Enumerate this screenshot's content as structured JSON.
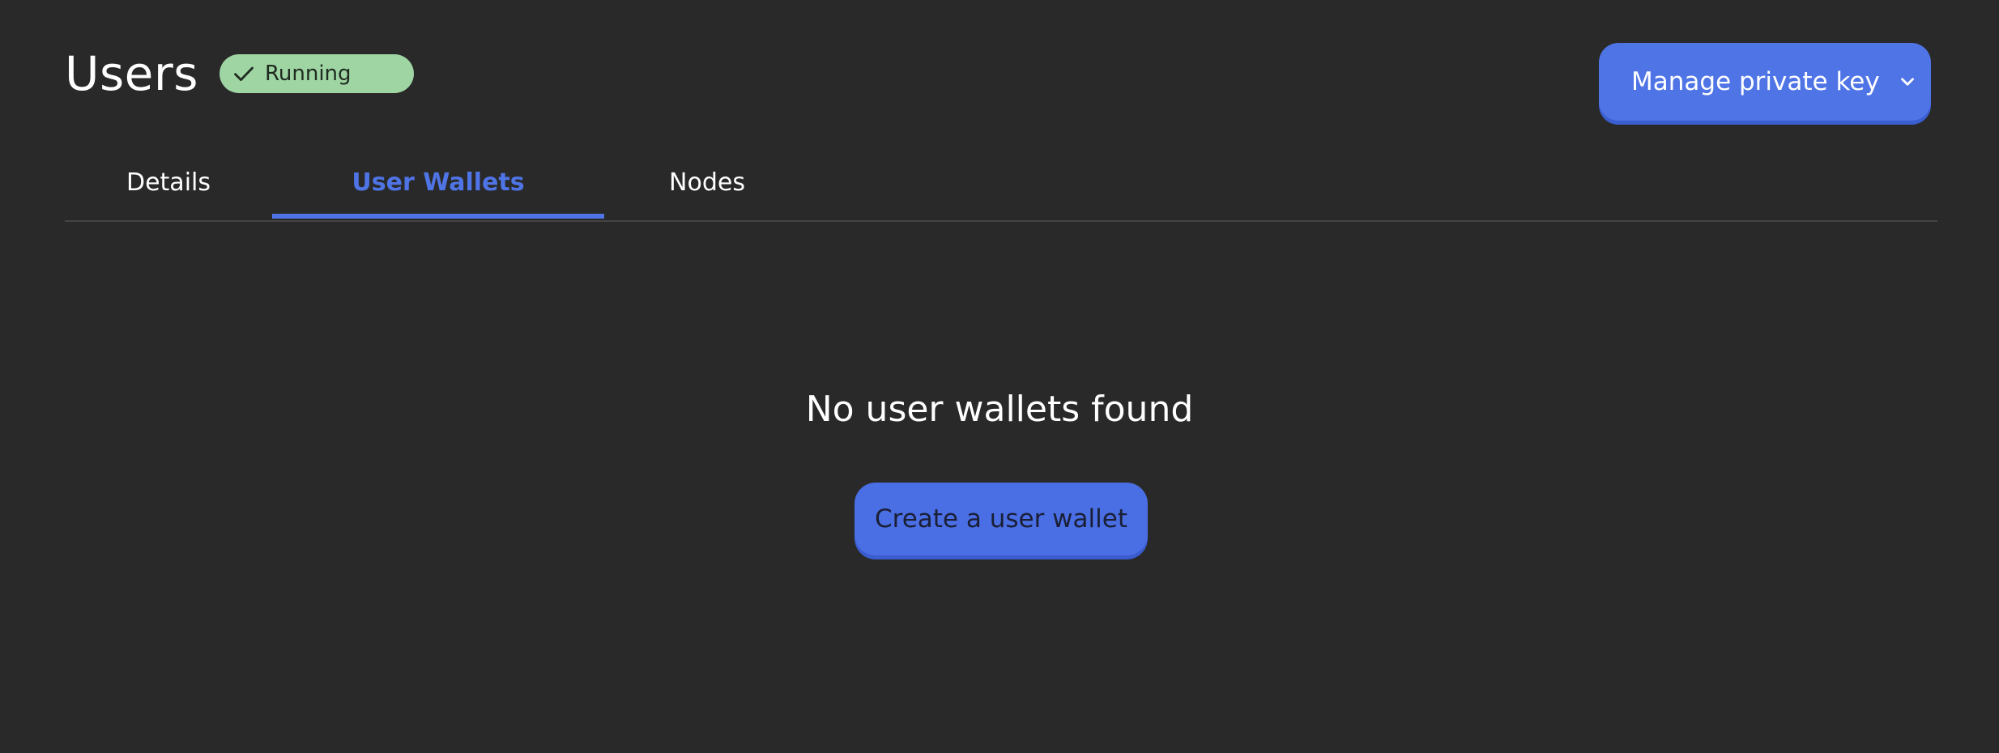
{
  "header": {
    "title": "Users",
    "status": {
      "label": "Running",
      "icon": "check-icon",
      "color": "#9ed5a3"
    },
    "manage_button": {
      "label": "Manage private key",
      "icon": "chevron-down-icon"
    }
  },
  "tabs": [
    {
      "label": "Details",
      "active": false
    },
    {
      "label": "User Wallets",
      "active": true
    },
    {
      "label": "Nodes",
      "active": false
    }
  ],
  "empty_state": {
    "message": "No user wallets found",
    "button_label": "Create a user wallet"
  },
  "colors": {
    "background": "#292929",
    "accent": "#4f74e6",
    "badge": "#9ed5a3"
  }
}
